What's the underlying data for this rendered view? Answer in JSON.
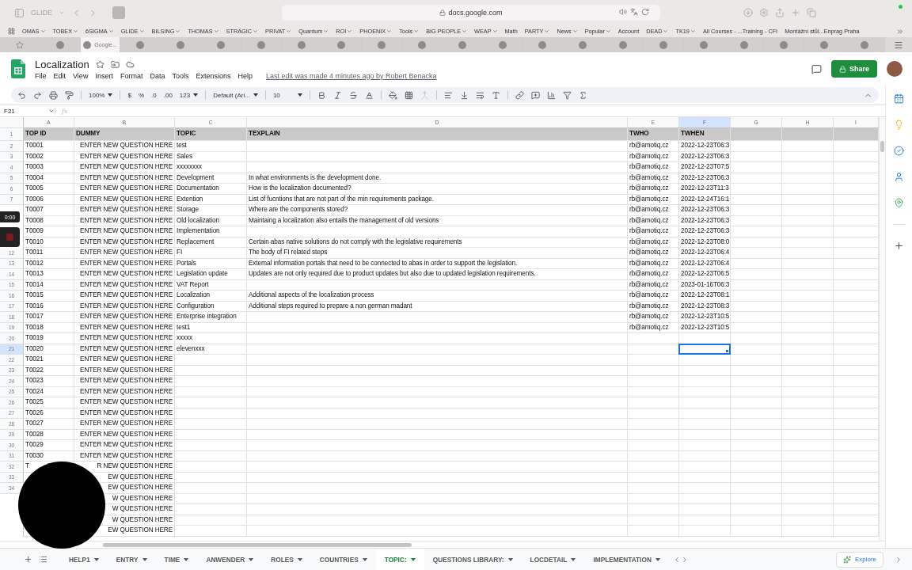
{
  "browser": {
    "profile": "GLIDE",
    "url": "docs.google.com",
    "bookmarks": [
      {
        "label": "OMAS",
        "folder": true
      },
      {
        "label": "TOBEX",
        "folder": true
      },
      {
        "label": "6SIGMA",
        "folder": true
      },
      {
        "label": "GLIDE",
        "folder": true
      },
      {
        "label": "BILSING",
        "folder": true
      },
      {
        "label": "THOMAS",
        "folder": true
      },
      {
        "label": "STRAGIC",
        "folder": true
      },
      {
        "label": "PRIVAT",
        "folder": true
      },
      {
        "label": "Quantum",
        "folder": true
      },
      {
        "label": "ROI",
        "folder": true
      },
      {
        "label": "PHOENIX",
        "folder": true
      },
      {
        "label": "Tools",
        "folder": true
      },
      {
        "label": "BIG PEOPLE",
        "folder": true
      },
      {
        "label": "WEAP",
        "folder": true
      },
      {
        "label": "Math",
        "folder": false
      },
      {
        "label": "PARTY",
        "folder": true
      },
      {
        "label": "News",
        "folder": true
      },
      {
        "label": "Popular",
        "folder": true
      },
      {
        "label": "Account",
        "folder": false
      },
      {
        "label": "DEAD",
        "folder": true
      },
      {
        "label": "TK19",
        "folder": true
      },
      {
        "label": "All Courses - ...Training - CFI",
        "folder": false
      },
      {
        "label": "Montážní stůl...Enprag Praha",
        "folder": false
      }
    ],
    "tabs": [
      {
        "kind": "star",
        "selected": false
      },
      {
        "kind": "site",
        "selected": false
      },
      {
        "kind": "site",
        "label": "Google...",
        "selected": true
      },
      {
        "kind": "site",
        "selected": false
      },
      {
        "kind": "site",
        "selected": false
      },
      {
        "kind": "site",
        "selected": false
      },
      {
        "kind": "site",
        "selected": false
      },
      {
        "kind": "site",
        "selected": false
      },
      {
        "kind": "site",
        "selected": false
      },
      {
        "kind": "site",
        "selected": false
      },
      {
        "kind": "site",
        "selected": false
      },
      {
        "kind": "site",
        "selected": false
      },
      {
        "kind": "site",
        "selected": false
      },
      {
        "kind": "site",
        "selected": false
      },
      {
        "kind": "site",
        "selected": false
      },
      {
        "kind": "site",
        "selected": false
      },
      {
        "kind": "site",
        "selected": false
      },
      {
        "kind": "site",
        "selected": false
      },
      {
        "kind": "site",
        "selected": false
      },
      {
        "kind": "site",
        "selected": false
      },
      {
        "kind": "site",
        "selected": false
      },
      {
        "kind": "site",
        "selected": false
      }
    ]
  },
  "document": {
    "title": "Localization",
    "menus": [
      "File",
      "Edit",
      "View",
      "Insert",
      "Format",
      "Data",
      "Tools",
      "Extensions",
      "Help"
    ],
    "last_edit": "Last edit was made 4 minutes ago by Robert Benacka",
    "share": "Share"
  },
  "toolbar": {
    "zoom": "100%",
    "currency": "$",
    "percent": "%",
    "decrease_decimals": ".0",
    "increase_decimals": ".00",
    "number_format": "123",
    "font": "Default (Ari...",
    "font_size": "10"
  },
  "formula_bar": {
    "name_box": "F21",
    "fx": "fx"
  },
  "grid": {
    "columns": [
      {
        "letter": "A",
        "header": "TOP ID",
        "selected": false
      },
      {
        "letter": "B",
        "header": "DUMMY",
        "selected": false
      },
      {
        "letter": "C",
        "header": "TOPIC",
        "selected": false
      },
      {
        "letter": "D",
        "header": "TEXPLAIN",
        "selected": false
      },
      {
        "letter": "E",
        "header": "TWHO",
        "selected": false
      },
      {
        "letter": "F",
        "header": "TWHEN",
        "selected": true
      },
      {
        "letter": "G",
        "selected": false
      },
      {
        "letter": "H",
        "selected": false
      },
      {
        "letter": "I",
        "selected": false
      }
    ],
    "header_row_num": "1",
    "rows": [
      {
        "num": "2",
        "selected": false,
        "cells": {
          "A": "T0001",
          "B": "ENTER NEW QUESTION HERE",
          "C": "test",
          "E": "rb@amotiq.cz",
          "F": "2022-12-23T06:3"
        }
      },
      {
        "num": "3",
        "selected": false,
        "cells": {
          "A": "T0002",
          "B": "ENTER NEW QUESTION HERE",
          "C": "Sales",
          "E": "rb@amotiq.cz",
          "F": "2022-12-23T06:3"
        }
      },
      {
        "num": "4",
        "selected": false,
        "cells": {
          "A": "T0003",
          "B": "ENTER NEW QUESTION HERE",
          "C": "xxxxxxxx",
          "E": "rb@amotiq.cz",
          "F": "2022-12-23T07:5"
        }
      },
      {
        "num": "5",
        "selected": false,
        "cells": {
          "A": "T0004",
          "B": "ENTER NEW QUESTION HERE",
          "C": "Development",
          "D": "In what environments is the development done.",
          "E": "rb@amotiq.cz",
          "F": "2022-12-23T06:3"
        }
      },
      {
        "num": "6",
        "selected": false,
        "cells": {
          "A": "T0005",
          "B": "ENTER NEW QUESTION HERE",
          "C": "Documentation",
          "D": "How is the localization documented?",
          "E": "rb@amotiq.cz",
          "F": "2022-12-23T11:3"
        }
      },
      {
        "num": "7",
        "selected": false,
        "cells": {
          "A": "T0006",
          "B": "ENTER NEW QUESTION HERE",
          "C": "Extention",
          "D": "List of fucntions that are not part of the min requirements package.",
          "E": "rb@amotiq.cz",
          "F": "2022-12-24T16:1"
        }
      },
      {
        "selected": false,
        "cells": {
          "A": "T0007",
          "B": "ENTER NEW QUESTION HERE",
          "C": "Storage",
          "D": "Where are the components stored?",
          "E": "rb@amotiq.cz",
          "F": "2022-12-23T06:3"
        }
      },
      {
        "selected": false,
        "cells": {
          "A": "T0008",
          "B": "ENTER NEW QUESTION HERE",
          "C": "Old localization",
          "D": "Maintaing a localization also entails the management of old versions",
          "E": "rb@amotiq.cz",
          "F": "2022-12-23T06:3"
        }
      },
      {
        "selected": false,
        "cells": {
          "A": "T0009",
          "B": "ENTER NEW QUESTION HERE",
          "C": "Implementation",
          "E": "rb@amotiq.cz",
          "F": "2022-12-23T06:3"
        }
      },
      {
        "selected": false,
        "cells": {
          "A": "T0010",
          "B": "ENTER NEW QUESTION HERE",
          "C": "Replacement",
          "D": "Certain abas native solutions do not comply with the legislative requirements",
          "E": "rb@amotiq.cz",
          "F": "2022-12-23T08:0"
        }
      },
      {
        "num": "12",
        "selected": false,
        "cells": {
          "A": "T0011",
          "B": "ENTER NEW QUESTION HERE",
          "C": "FI",
          "D": "The body of FI related steps",
          "E": "rb@amotiq.cz",
          "F": "2022-12-23T06:4"
        }
      },
      {
        "num": "13",
        "selected": false,
        "cells": {
          "A": "T0012",
          "B": "ENTER NEW QUESTION HERE",
          "C": "Portals",
          "D": "External information portals that need to be connected to abas in order to support the legislation.",
          "E": "rb@amotiq.cz",
          "F": "2022-12-23T06:4"
        }
      },
      {
        "num": "14",
        "selected": false,
        "cells": {
          "A": "T0013",
          "B": "ENTER NEW QUESTION HERE",
          "C": "Legislation update",
          "D": "Updates are not only required due to product updates but also due to updated legislation requirements.",
          "E": "rb@amotiq.cz",
          "F": "2022-12-23T06:5"
        }
      },
      {
        "num": "15",
        "selected": false,
        "cells": {
          "A": "T0014",
          "B": "ENTER NEW QUESTION HERE",
          "C": "VAT Report",
          "E": "rb@amotiq.cz",
          "F": "2023-01-16T06:3"
        }
      },
      {
        "num": "16",
        "selected": false,
        "cells": {
          "A": "T0015",
          "B": "ENTER NEW QUESTION HERE",
          "C": "Localization",
          "D": "Additional aspects of the localization process",
          "E": "rb@amotiq.cz",
          "F": "2022-12-23T08:1"
        }
      },
      {
        "num": "17",
        "selected": false,
        "cells": {
          "A": "T0016",
          "B": "ENTER NEW QUESTION HERE",
          "C": "Configuration",
          "D": "Additional steps required to prepare a non german madant",
          "E": "rb@amotiq.cz",
          "F": "2022-12-23T08:3"
        }
      },
      {
        "num": "18",
        "selected": false,
        "cells": {
          "A": "T0017",
          "B": "ENTER NEW QUESTION HERE",
          "C": "Enterprise integration",
          "E": "rb@amotiq.cz",
          "F": "2022-12-23T10:5"
        }
      },
      {
        "num": "19",
        "selected": false,
        "cells": {
          "A": "T0018",
          "B": "ENTER NEW QUESTION HERE",
          "C": "test1",
          "E": "rb@amotiq.cz",
          "F": "2022-12-23T10:5"
        }
      },
      {
        "num": "20",
        "selected": false,
        "cells": {
          "A": "T0019",
          "B": "ENTER NEW QUESTION HERE",
          "C": "xxxxx"
        }
      },
      {
        "num": "21",
        "selected": true,
        "cells": {
          "A": "T0020",
          "B": "ENTER NEW QUESTION HERE",
          "C": "elevenxxx"
        }
      },
      {
        "num": "22",
        "selected": false,
        "cells": {
          "A": "T0021",
          "B": "ENTER NEW QUESTION HERE"
        }
      },
      {
        "num": "23",
        "selected": false,
        "cells": {
          "A": "T0022",
          "B": "ENTER NEW QUESTION HERE"
        }
      },
      {
        "num": "24",
        "selected": false,
        "cells": {
          "A": "T0023",
          "B": "ENTER NEW QUESTION HERE"
        }
      },
      {
        "num": "25",
        "selected": false,
        "cells": {
          "A": "T0024",
          "B": "ENTER NEW QUESTION HERE"
        }
      },
      {
        "num": "26",
        "selected": false,
        "cells": {
          "A": "T0025",
          "B": "ENTER NEW QUESTION HERE"
        }
      },
      {
        "num": "27",
        "selected": false,
        "cells": {
          "A": "T0026",
          "B": "ENTER NEW QUESTION HERE"
        }
      },
      {
        "num": "28",
        "selected": false,
        "cells": {
          "A": "T0027",
          "B": "ENTER NEW QUESTION HERE"
        }
      },
      {
        "num": "29",
        "selected": false,
        "cells": {
          "A": "T0028",
          "B": "ENTER NEW QUESTION HERE"
        }
      },
      {
        "num": "30",
        "selected": false,
        "cells": {
          "A": "T0029",
          "B": "ENTER NEW QUESTION HERE"
        }
      },
      {
        "num": "31",
        "selected": false,
        "cells": {
          "A": "T0030",
          "B": "ENTER NEW QUESTION HERE"
        }
      },
      {
        "num": "32",
        "selected": false,
        "cells": {
          "A": "T",
          "B": "R NEW QUESTION HERE"
        }
      },
      {
        "num": "33",
        "selected": false,
        "cells": {
          "B": "EW QUESTION HERE"
        }
      },
      {
        "num": "34",
        "selected": false,
        "cells": {
          "B": "EW QUESTION HERE"
        }
      },
      {
        "selected": false,
        "cells": {
          "B": "W QUESTION HERE"
        }
      },
      {
        "selected": false,
        "cells": {
          "B": "W QUESTION HERE"
        }
      },
      {
        "selected": false,
        "cells": {
          "B": "W QUESTION HERE"
        }
      },
      {
        "selected": false,
        "cells": {
          "B": "EW QUESTION HERE"
        }
      }
    ]
  },
  "sheet_tabs": [
    {
      "label": "HELP1",
      "selected": false
    },
    {
      "label": "ENTRY",
      "selected": false
    },
    {
      "label": "TIME",
      "selected": false
    },
    {
      "label": "ANWENDER",
      "selected": false
    },
    {
      "label": "ROLES",
      "selected": false
    },
    {
      "label": "COUNTRIES",
      "selected": false
    },
    {
      "label": "TOPIC:",
      "selected": true
    },
    {
      "label": "QUESTIONS LIBRARY:",
      "selected": false
    },
    {
      "label": "LOCDETAIL",
      "selected": false
    },
    {
      "label": "IMPLEMENTATION",
      "selected": false
    }
  ],
  "explore": "Explore",
  "recorder": {
    "timer": "0:00"
  }
}
